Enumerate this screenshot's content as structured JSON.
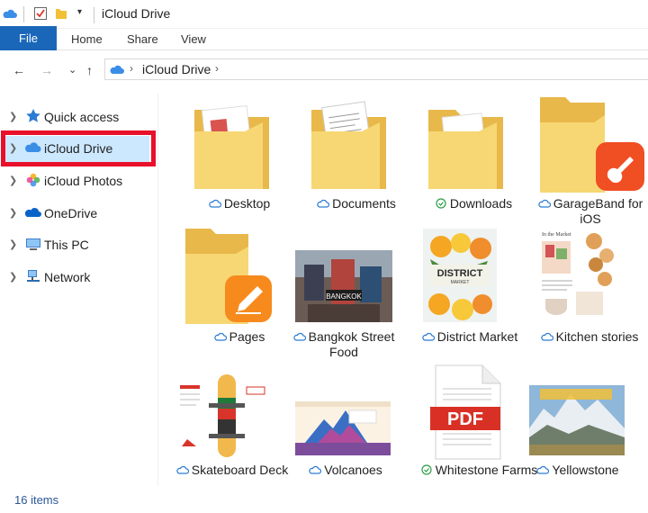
{
  "window": {
    "title": "iCloud Drive"
  },
  "ribbon": {
    "file": "File",
    "home": "Home",
    "share": "Share",
    "view": "View"
  },
  "address": {
    "location": "iCloud Drive"
  },
  "sidebar": {
    "items": [
      {
        "label": "Quick access",
        "icon": "star-icon"
      },
      {
        "label": "iCloud Drive",
        "icon": "icloud-icon",
        "selected": true
      },
      {
        "label": "iCloud Photos",
        "icon": "photos-icon"
      },
      {
        "label": "OneDrive",
        "icon": "onedrive-cloud-icon"
      },
      {
        "label": "This PC",
        "icon": "computer-icon"
      },
      {
        "label": "Network",
        "icon": "network-icon"
      }
    ]
  },
  "files": [
    {
      "name": "Desktop",
      "status": "cloud",
      "kind": "folder"
    },
    {
      "name": "Documents",
      "status": "cloud",
      "kind": "folder"
    },
    {
      "name": "Downloads",
      "status": "synced",
      "kind": "folder"
    },
    {
      "name": "GarageBand for iOS",
      "status": "cloud",
      "kind": "folder-app"
    },
    {
      "name": "Pages",
      "status": "cloud",
      "kind": "folder-app"
    },
    {
      "name": "Bangkok Street Food",
      "status": "cloud",
      "kind": "image",
      "thumb_text": "BANGKOK"
    },
    {
      "name": "District Market",
      "status": "cloud",
      "kind": "image",
      "thumb_text": "DISTRICT",
      "thumb_subtext": "MARKET"
    },
    {
      "name": "Kitchen stories",
      "status": "cloud",
      "kind": "document",
      "thumb_text": "In the Market"
    },
    {
      "name": "Skateboard Deck",
      "status": "cloud",
      "kind": "document"
    },
    {
      "name": "Volcanoes",
      "status": "cloud",
      "kind": "image"
    },
    {
      "name": "Whitestone Farms",
      "status": "synced",
      "kind": "pdf",
      "thumb_text": "PDF"
    },
    {
      "name": "Yellowstone",
      "status": "cloud",
      "kind": "image"
    }
  ],
  "status": {
    "count": "16 items"
  },
  "colors": {
    "accent": "#1a67b9",
    "selection": "#cce8ff",
    "highlight_box": "#e8102a",
    "folder": "#f7d774",
    "pdf_red": "#d93025",
    "synced_green": "#2e9d46"
  }
}
